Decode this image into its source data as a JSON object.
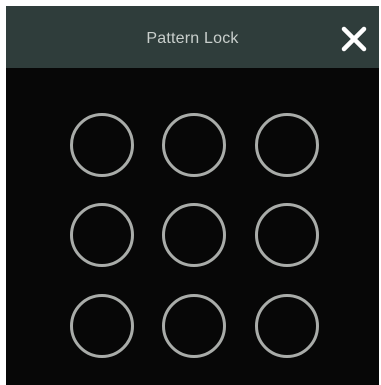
{
  "dialog": {
    "title": "Pattern Lock",
    "close_icon": "close-icon"
  },
  "pattern": {
    "rows": 3,
    "cols": 3,
    "selected": []
  },
  "colors": {
    "titlebar": "#2f3d3b",
    "background": "#070707",
    "ring": "#a9aca9",
    "title_text": "#c9cfcc"
  }
}
